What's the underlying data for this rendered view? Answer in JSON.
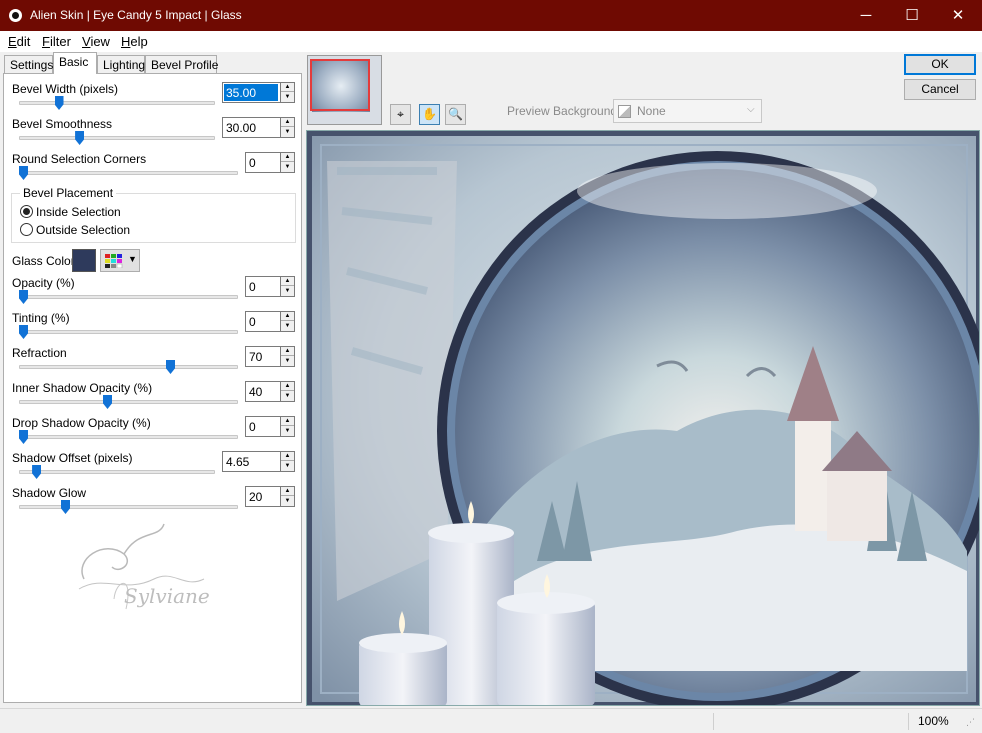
{
  "window": {
    "title": "Alien Skin | Eye Candy 5 Impact | Glass",
    "minimize": "─",
    "maximize": "☐",
    "close": "✕",
    "titlebar_color": "#6f0a02"
  },
  "menu": [
    {
      "label": "Edit",
      "accel": "E",
      "rest": "dit"
    },
    {
      "label": "Filter",
      "accel": "F",
      "rest": "ilter"
    },
    {
      "label": "View",
      "accel": "V",
      "rest": "iew"
    },
    {
      "label": "Help",
      "accel": "H",
      "rest": "elp"
    }
  ],
  "tabs": [
    "Settings",
    "Basic",
    "Lighting",
    "Bevel Profile"
  ],
  "active_tab": "Basic",
  "controls": {
    "bevel_width": {
      "label": "Bevel Width (pixels)",
      "value": "35.00",
      "level": 0.19
    },
    "bevel_smoothness": {
      "label": "Bevel Smoothness",
      "value": "30.00",
      "level": 0.3
    },
    "round_corners": {
      "label": "Round Selection Corners",
      "value": "0",
      "level": 0.0
    },
    "bevel_placement": {
      "label": "Bevel Placement",
      "options": [
        "Inside Selection",
        "Outside Selection"
      ],
      "selected": "Inside Selection"
    },
    "glass_color": {
      "label": "Glass Color",
      "swatch": "#2e3a5c"
    },
    "opacity": {
      "label": "Opacity (%)",
      "value": "0",
      "level": 0.0
    },
    "tinting": {
      "label": "Tinting (%)",
      "value": "0",
      "level": 0.0
    },
    "refraction": {
      "label": "Refraction",
      "value": "70",
      "level": 0.7
    },
    "inner_shadow_opacity": {
      "label": "Inner Shadow Opacity (%)",
      "value": "40",
      "level": 0.4
    },
    "drop_shadow_opacity": {
      "label": "Drop Shadow Opacity (%)",
      "value": "0",
      "level": 0.0
    },
    "shadow_offset": {
      "label": "Shadow Offset (pixels)",
      "value": "4.65",
      "level": 0.07
    },
    "shadow_glow": {
      "label": "Shadow Glow",
      "value": "20",
      "level": 0.2
    }
  },
  "watermark_text": "Sylviane",
  "buttons": {
    "ok": "OK",
    "cancel": "Cancel"
  },
  "preview_background": {
    "label": "Preview Background:",
    "value": "None"
  },
  "tools": [
    "navigator-icon",
    "hand-icon",
    "zoom-icon"
  ],
  "status": {
    "zoom": "100%"
  },
  "accent_color": "#0078d7",
  "slider_color": "#1172d6"
}
